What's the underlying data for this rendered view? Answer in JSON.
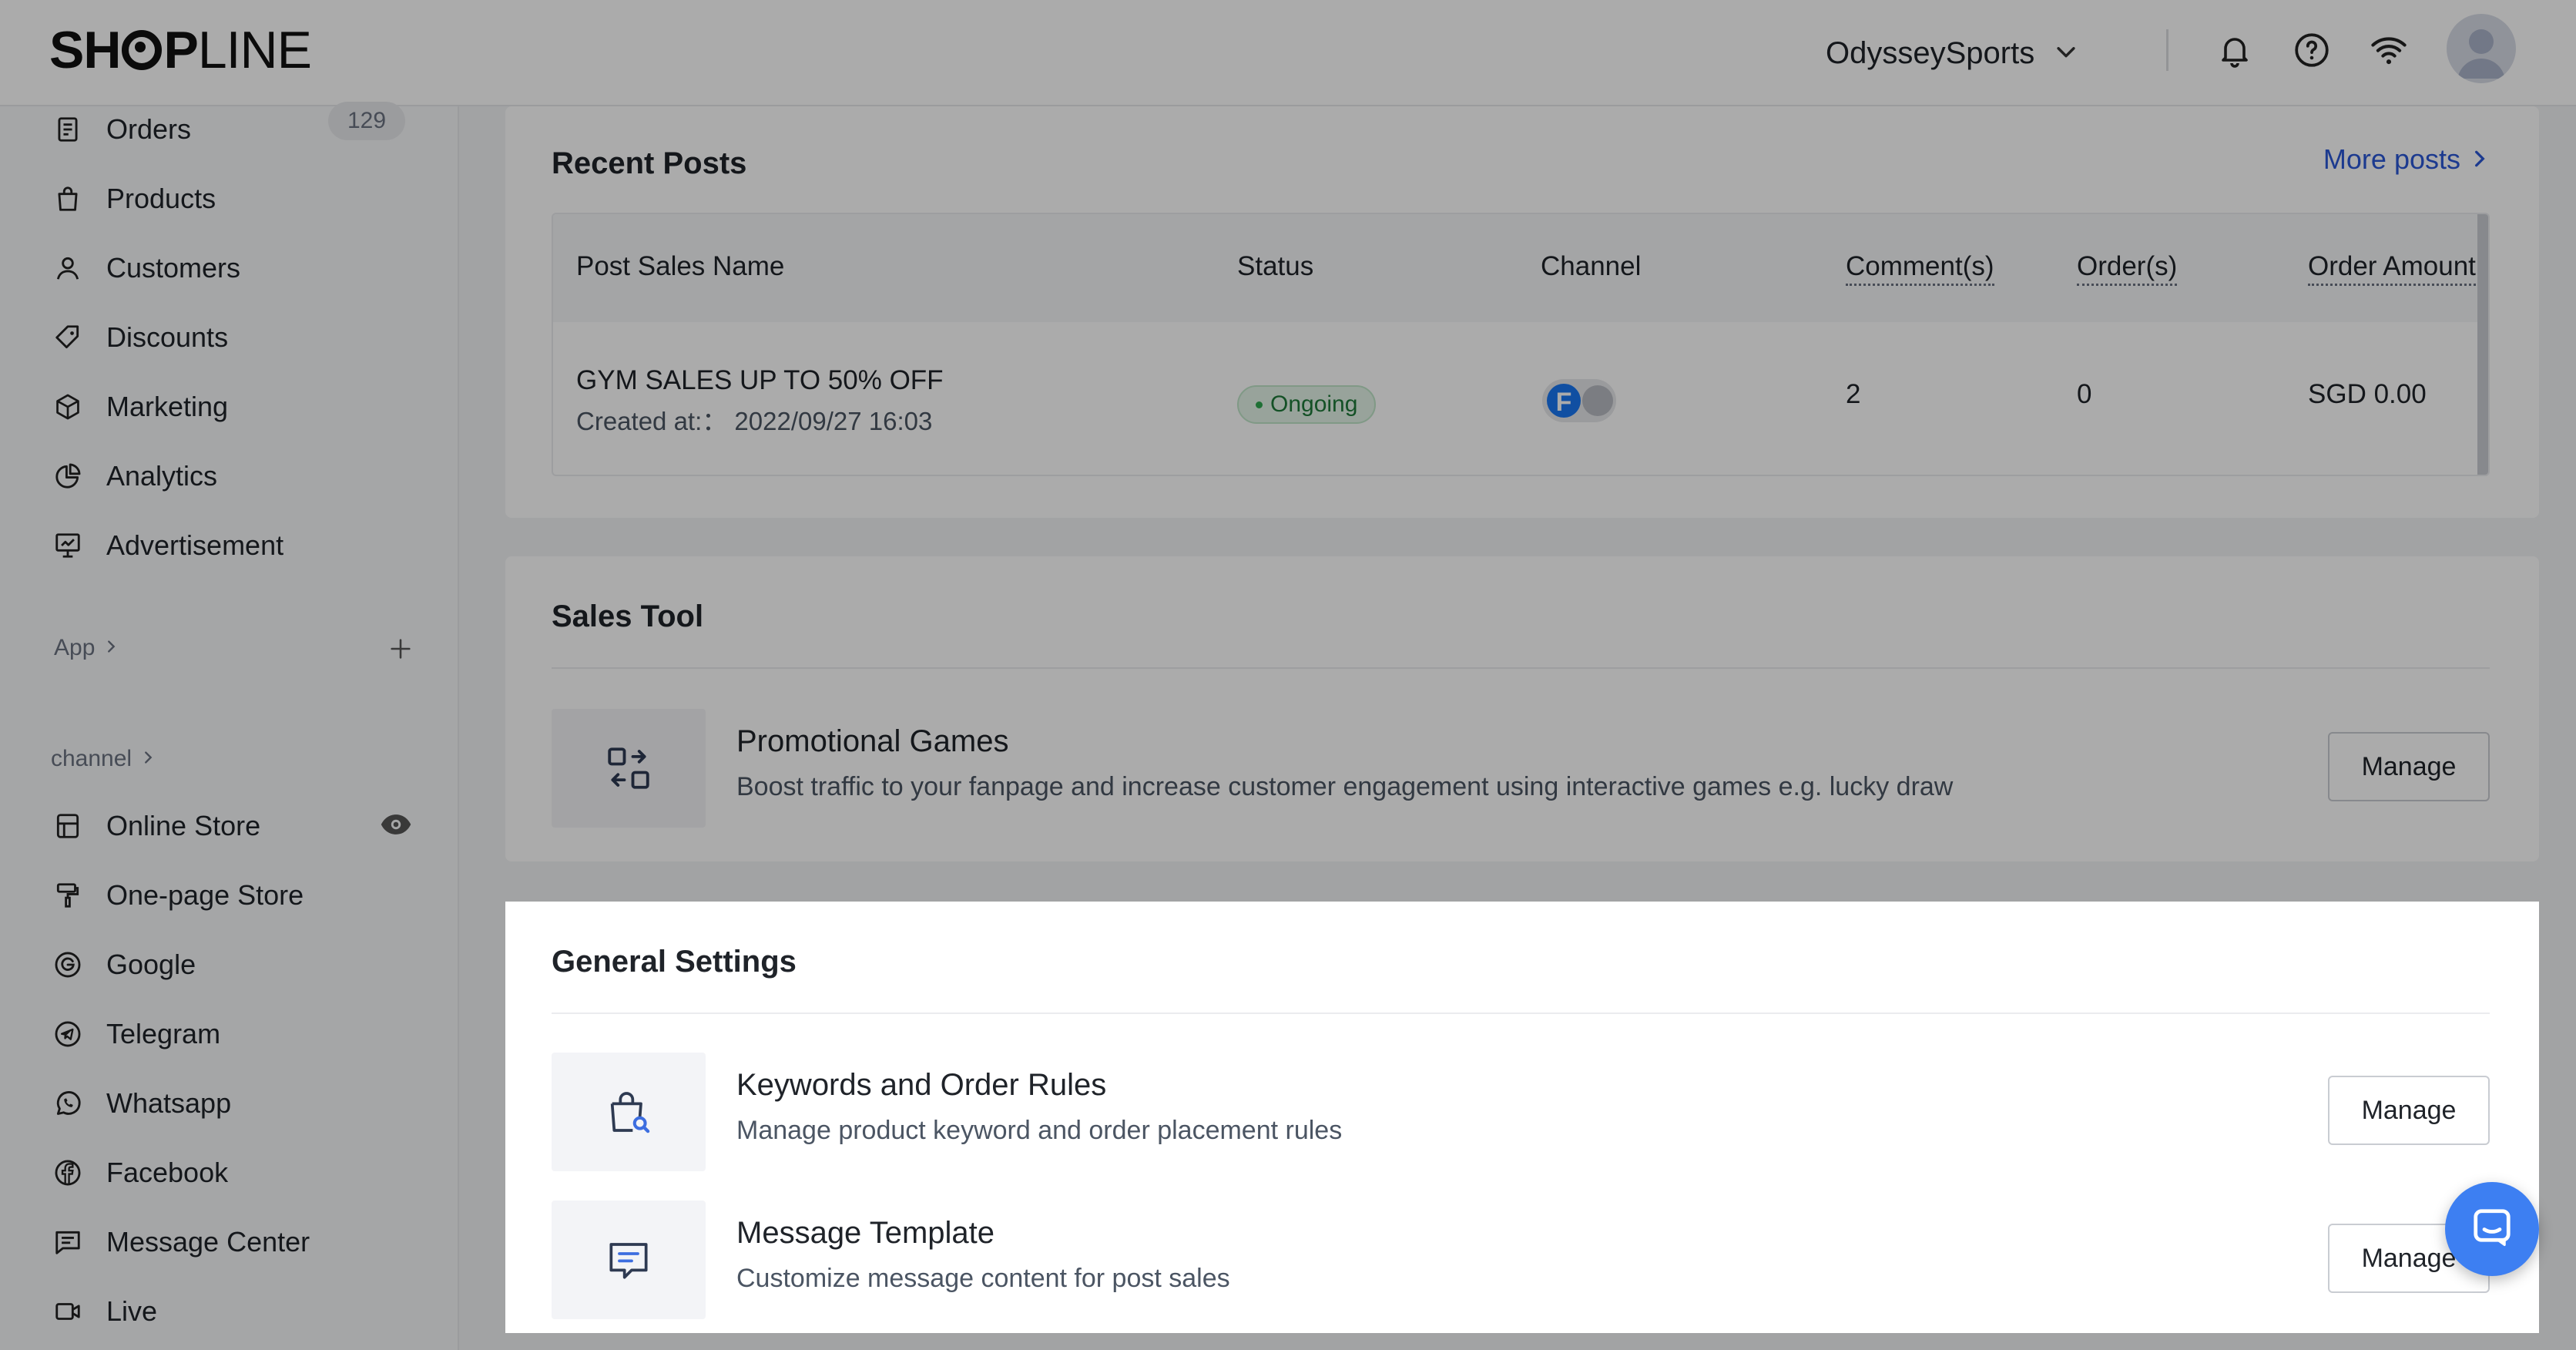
{
  "header": {
    "logo_text_bold": "SH",
    "logo_text_bold2": "P",
    "logo_text_light": "LINE",
    "store_name": "OdysseySports",
    "icons": [
      "bell-icon",
      "help-icon",
      "wifi-icon",
      "avatar"
    ]
  },
  "sidebar": {
    "items_top": [
      {
        "label": "Orders",
        "icon": "orders-icon",
        "badge": "129"
      },
      {
        "label": "Products",
        "icon": "bag-icon"
      },
      {
        "label": "Customers",
        "icon": "person-icon"
      },
      {
        "label": "Discounts",
        "icon": "tag-icon"
      },
      {
        "label": "Marketing",
        "icon": "cube-icon"
      },
      {
        "label": "Analytics",
        "icon": "pie-icon"
      },
      {
        "label": "Advertisement",
        "icon": "billboard-icon"
      }
    ],
    "app_label": "App",
    "channel_label": "channel",
    "items_channel": [
      {
        "label": "Online Store",
        "icon": "store-icon"
      },
      {
        "label": "One-page Store",
        "icon": "paint-roller-icon"
      },
      {
        "label": "Google",
        "icon": "google-icon"
      },
      {
        "label": "Telegram",
        "icon": "telegram-icon"
      },
      {
        "label": "Whatsapp",
        "icon": "whatsapp-icon"
      },
      {
        "label": "Facebook",
        "icon": "facebook-icon"
      },
      {
        "label": "Message Center",
        "icon": "message-icon"
      },
      {
        "label": "Live",
        "icon": "video-icon"
      }
    ]
  },
  "recent_posts": {
    "title": "Recent Posts",
    "more_link": "More posts",
    "columns": [
      "Post Sales Name",
      "Status",
      "Channel",
      "Comment(s)",
      "Order(s)",
      "Order Amount"
    ],
    "rows": [
      {
        "name": "GYM SALES UP TO 50% OFF",
        "created": "Created at:：  2022/09/27 16:03",
        "status": "Ongoing",
        "channel_icon": "F",
        "comments": "2",
        "orders": "0",
        "amount": "SGD 0.00"
      }
    ]
  },
  "sales_tool": {
    "title": "Sales Tool",
    "items": [
      {
        "name": "Promotional Games",
        "desc": "Boost traffic to your fanpage and increase customer engagement using interactive games e.g. lucky draw",
        "button": "Manage"
      }
    ]
  },
  "general_settings": {
    "title": "General Settings",
    "items": [
      {
        "name": "Keywords and Order Rules",
        "desc": "Manage product keyword and order placement rules",
        "button": "Manage"
      },
      {
        "name": "Message Template",
        "desc": "Customize message content for post sales",
        "button": "Manage"
      }
    ]
  },
  "colors": {
    "accent": "#2b57d6",
    "success": "#2fa84f",
    "chat": "#3d7ff2"
  }
}
